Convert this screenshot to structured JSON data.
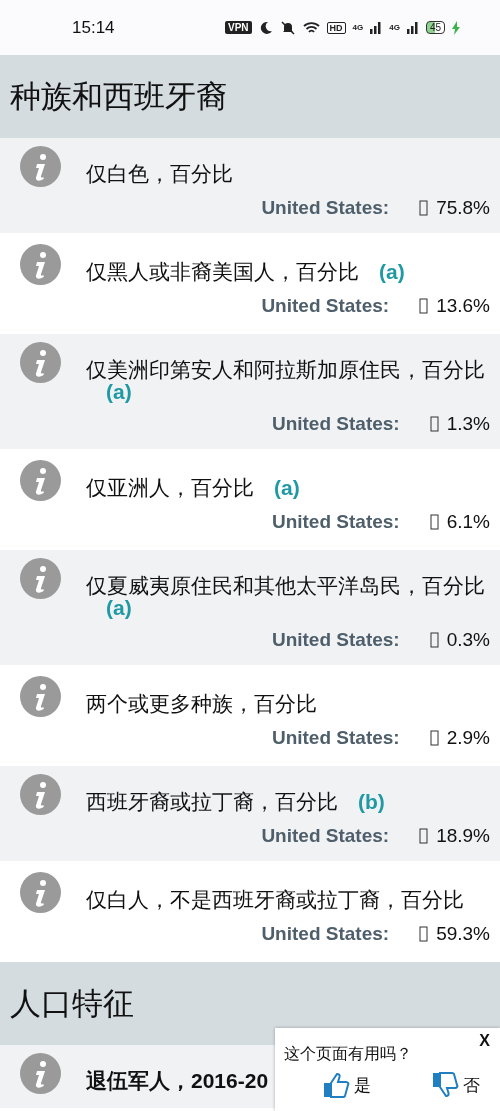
{
  "status_bar": {
    "time": "15:14",
    "vpn": "VPN",
    "hd": "HD",
    "signal_1": "4G",
    "signal_2": "4G",
    "battery": "45"
  },
  "sections": [
    {
      "title": "种族和西班牙裔",
      "rows": [
        {
          "label": "仅白色，百分比",
          "region": "United States:",
          "value": "75.8%"
        },
        {
          "label": "仅黑人或非裔美国人，百分比",
          "note": "(a)",
          "region": "United States:",
          "value": "13.6%"
        },
        {
          "label": "仅美洲印第安人和阿拉斯加原住民，百分比",
          "note": "(a)",
          "region": "United States:",
          "value": "1.3%"
        },
        {
          "label": "仅亚洲人，百分比",
          "note": "(a)",
          "region": "United States:",
          "value": "6.1%"
        },
        {
          "label": "仅夏威夷原住民和其他太平洋岛民，百分比",
          "note": "(a)",
          "region": "United States:",
          "value": "0.3%"
        },
        {
          "label": "两个或更多种族，百分比",
          "region": "United States:",
          "value": "2.9%"
        },
        {
          "label": "西班牙裔或拉丁裔，百分比",
          "note": "(b)",
          "region": "United States:",
          "value": "18.9%"
        },
        {
          "label": "仅白人，不是西班牙裔或拉丁裔，百分比",
          "region": "United States:",
          "value": "59.3%"
        }
      ]
    },
    {
      "title": "人口特征",
      "rows": [
        {
          "label": "退伍军人，2016-20",
          "bold": true
        }
      ]
    }
  ],
  "feedback": {
    "close": "X",
    "question": "这个页面有用吗？",
    "yes": "是",
    "no": "否"
  }
}
